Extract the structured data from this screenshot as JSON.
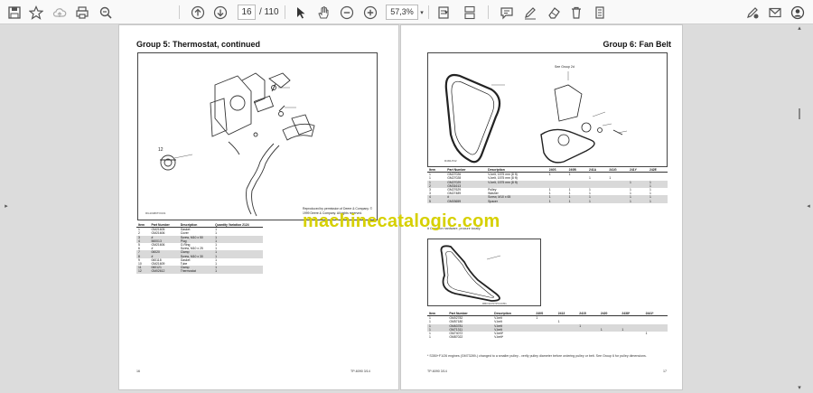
{
  "toolbar": {
    "current_page": "16",
    "total_pages": "/ 110",
    "zoom": "57,3%"
  },
  "left_page": {
    "title": "Group 5:  Thermostat, continued",
    "copyright": "Reproduced by permission of Deere & Company. © 1999 Deere & Company. All rights reserved.",
    "image_code": "RG10480TOU01",
    "callout": "12",
    "table": {
      "headers": [
        "Item",
        "Part Number",
        "Description",
        "Quantity Variation 2124"
      ],
      "rows": [
        [
          "1",
          "GM21605",
          "Gasket",
          "1"
        ],
        [
          "2",
          "GM21606",
          "Cover",
          "1"
        ],
        [
          "3",
          "#",
          "Screw, M10 x 50",
          "1"
        ],
        [
          "4",
          "560013",
          "Plug",
          "1"
        ],
        [
          "5",
          "GM21606",
          "O-Ring",
          "1"
        ],
        [
          "6",
          "#",
          "Screw, M10 x 25",
          "1"
        ],
        [
          "7",
          "06020",
          "Clamp",
          "1"
        ],
        [
          "8",
          "#",
          "Screw, M10 x 30",
          "1"
        ],
        [
          "9",
          "060118",
          "Gasket",
          "1"
        ],
        [
          "10",
          "GM21609",
          "Tube",
          "1"
        ],
        [
          "11",
          "060121",
          "Clamp",
          "1"
        ],
        [
          "12",
          "GM02612",
          "Thermostat",
          "1"
        ]
      ]
    },
    "footer_left": "16",
    "footer_right": "TP-6090  3/14"
  },
  "right_page": {
    "title": "Group 6:  Fan Belt",
    "see_group": "See Group 2d",
    "image_code": "R4MH732",
    "image_code_2": "RBO1070TPCCD51",
    "table1": {
      "headers": [
        "Item",
        "Part Number",
        "Description",
        "240S",
        "240B",
        "241A",
        "241G",
        "241Y",
        "242E"
      ],
      "group_label": "Quantity Variation",
      "rows": [
        [
          "1",
          "GM27026",
          "V-belt, 1575 mm (8 ft)",
          "1",
          "1",
          "",
          "",
          "",
          ""
        ],
        [
          "1",
          "GM27028",
          "V-belt, 1575 mm (8 ft)",
          "",
          "",
          "1",
          "1",
          "",
          ""
        ],
        [
          "1",
          "GM27029",
          "V-belt, 1575 mm (8 ft)",
          "",
          "",
          "",
          "",
          "1",
          "1"
        ],
        [
          "2",
          "GM31613",
          "",
          "",
          "",
          "",
          "",
          "",
          "1"
        ],
        [
          "3",
          "GM27629",
          "Pulley",
          "1",
          "1",
          "1",
          "",
          "1",
          "1"
        ],
        [
          "3",
          "GM27489",
          "Washer",
          "1",
          "1",
          "1",
          "",
          "1",
          "1"
        ],
        [
          "4",
          "#",
          "Screw, M10 x 65",
          "1",
          "1",
          "1",
          "",
          "1",
          "1"
        ],
        [
          "5",
          "GM03659",
          "Spacer",
          "1",
          "1",
          "1",
          "",
          "1",
          "1"
        ]
      ],
      "note": "# Common hardware, procure locally"
    },
    "table2": {
      "headers": [
        "Item",
        "Part Number",
        "Description",
        "240S",
        "2413",
        "2415",
        "2420",
        "2438*",
        "2441*"
      ],
      "group_label": "Quantity Variation",
      "rows": [
        [
          "1",
          "GM02782",
          "V-belt",
          "1",
          "",
          "",
          "",
          "",
          ""
        ],
        [
          "1",
          "GM57180",
          "V-belt",
          "",
          "1",
          "",
          "",
          "",
          ""
        ],
        [
          "1",
          "GM63781",
          "V-belt",
          "",
          "",
          "1",
          "",
          "",
          ""
        ],
        [
          "1",
          "GM71311",
          "V-belt",
          "",
          "",
          "",
          "1",
          "1",
          ""
        ],
        [
          "1",
          "GM74072",
          "V-belt*",
          "",
          "",
          "",
          "",
          "",
          "1"
        ],
        [
          "1",
          "GM87022",
          "V-belt*",
          "",
          "",
          "",
          "",
          "",
          ""
        ]
      ],
      "note": "* S350+F1/26 engines (GM73289-) changed to a smaller pulley - verify pulley diameter before ordering pulley or belt. See Group 6 for pulley dimensions."
    },
    "footer_left": "TP-6090  3/14",
    "footer_right": "17"
  },
  "watermark": "machinecatalogic.com",
  "icons": [
    "save-icon",
    "bookmark-icon",
    "upload-icon",
    "print-icon",
    "zoom-out-icon",
    "prev-page-icon",
    "next-page-icon",
    "select-cursor-icon",
    "hand-icon",
    "zoom-minus-icon",
    "zoom-plus-icon",
    "fit-page-icon",
    "scroll-mode-icon",
    "comment-icon",
    "highlight-icon",
    "erase-icon",
    "delete-icon",
    "more-icon",
    "sign-icon",
    "email-icon",
    "account-icon"
  ]
}
